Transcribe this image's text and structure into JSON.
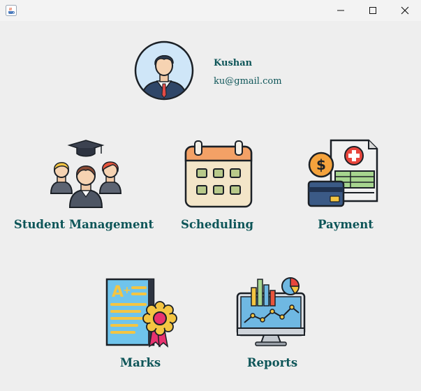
{
  "window": {
    "app_icon": "java-cup-icon",
    "controls": [
      "minimize-icon",
      "maximize-icon",
      "close-icon"
    ]
  },
  "profile": {
    "avatar_icon": "businessman-avatar-icon",
    "name": "Kushan",
    "email": "ku@gmail.com"
  },
  "tiles": {
    "student_management": {
      "label": "Student Management",
      "icon": "students-graduation-icon"
    },
    "scheduling": {
      "label": "Scheduling",
      "icon": "calendar-icon"
    },
    "payment": {
      "label": "Payment",
      "icon": "payment-invoice-icon"
    },
    "marks": {
      "label": "Marks",
      "icon": "grade-certificate-icon"
    },
    "reports": {
      "label": "Reports",
      "icon": "analytics-monitor-icon"
    }
  },
  "colors": {
    "label_text": "#0d5558",
    "background": "#eeeeee",
    "titlebar": "#f3f3f3"
  }
}
